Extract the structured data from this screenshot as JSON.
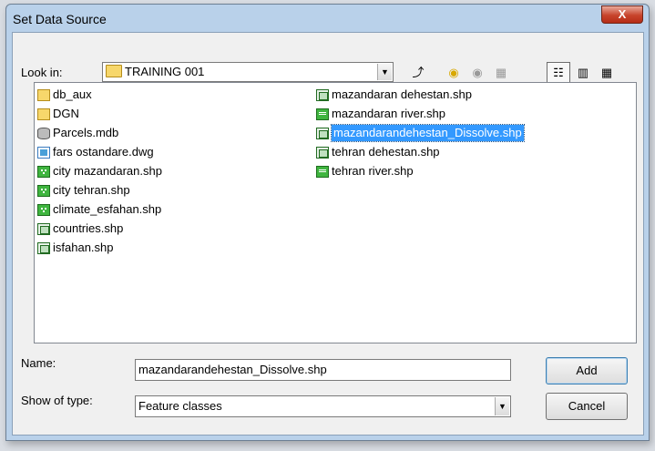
{
  "window": {
    "title": "Set Data Source",
    "close_glyph": "X"
  },
  "lookin": {
    "label": "Look in:",
    "value": "TRAINING 001"
  },
  "toolbar": [
    "up-one-level-icon",
    "connect-to-folder-icon",
    "disconnect-icon",
    "catalog-icon",
    "list-view-icon",
    "details-view-icon",
    "thumbnails-view-icon"
  ],
  "files_col1": [
    {
      "name": "db_aux",
      "icon": "folder"
    },
    {
      "name": "DGN",
      "icon": "folder"
    },
    {
      "name": "Parcels.mdb",
      "icon": "db"
    },
    {
      "name": "fars ostandare.dwg",
      "icon": "dwg"
    },
    {
      "name": "city mazandaran.shp",
      "icon": "point"
    },
    {
      "name": "city tehran.shp",
      "icon": "point"
    },
    {
      "name": "climate_esfahan.shp",
      "icon": "point"
    },
    {
      "name": "countries.shp",
      "icon": "poly"
    },
    {
      "name": "isfahan.shp",
      "icon": "poly"
    }
  ],
  "files_col2": [
    {
      "name": "mazandaran dehestan.shp",
      "icon": "poly"
    },
    {
      "name": "mazandaran river.shp",
      "icon": "line"
    },
    {
      "name": "mazandarandehestan_Dissolve.shp",
      "icon": "poly",
      "selected": true
    },
    {
      "name": "tehran dehestan.shp",
      "icon": "poly"
    },
    {
      "name": "tehran river.shp",
      "icon": "line"
    }
  ],
  "name_field": {
    "label": "Name:",
    "value": "mazandarandehestan_Dissolve.shp"
  },
  "type_field": {
    "label": "Show of type:",
    "value": "Feature classes"
  },
  "buttons": {
    "add": "Add",
    "cancel": "Cancel"
  },
  "colors": {
    "selection": "#3399ff",
    "frame": "#b9d1ea"
  }
}
